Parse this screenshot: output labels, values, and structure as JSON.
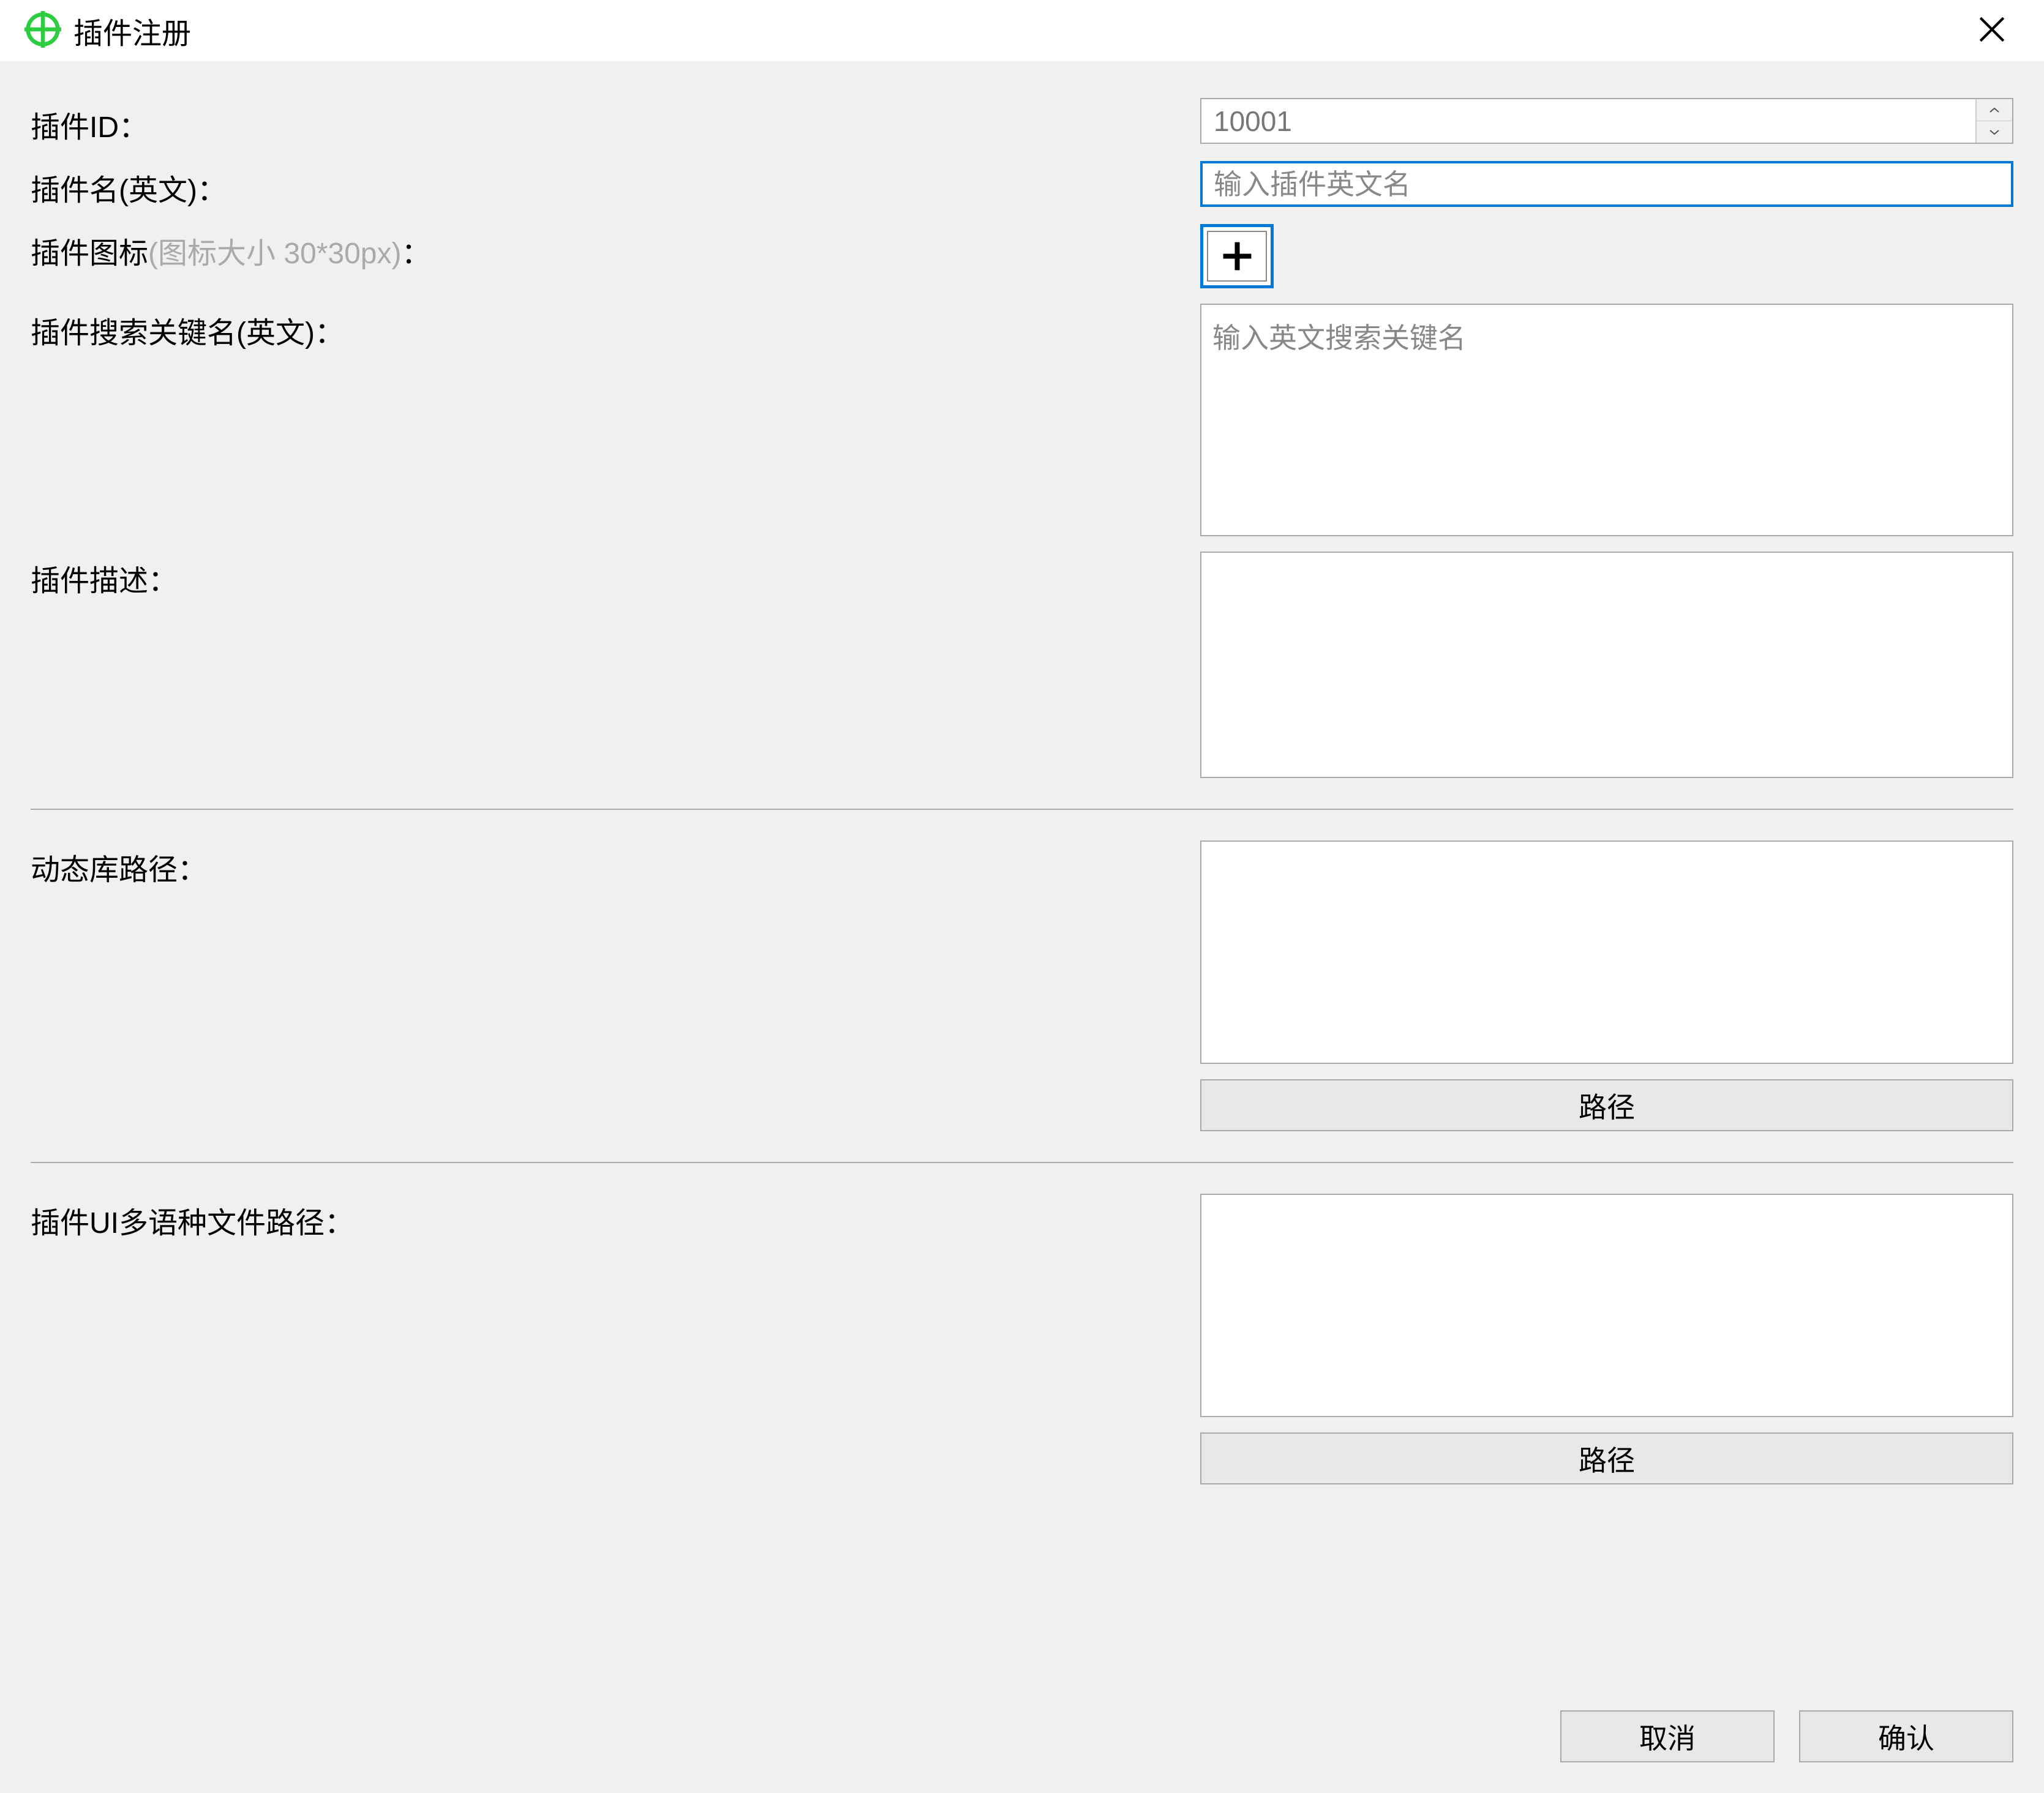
{
  "window": {
    "title": "插件注册"
  },
  "form": {
    "plugin_id": {
      "label": "插件ID：",
      "value": "10001"
    },
    "plugin_name": {
      "label": "插件名(英文)：",
      "placeholder": "输入插件英文名",
      "value": ""
    },
    "plugin_icon": {
      "label_prefix": "插件图标",
      "label_hint": "(图标大小 30*30px)",
      "label_suffix": "："
    },
    "search_key": {
      "label": "插件搜索关键名(英文)：",
      "placeholder": "输入英文搜索关键名",
      "value": ""
    },
    "description": {
      "label": "插件描述：",
      "value": ""
    },
    "lib_path": {
      "label": "动态库路径：",
      "value": "",
      "button": "路径"
    },
    "ui_path": {
      "label": "插件UI多语种文件路径：",
      "value": "",
      "button": "路径"
    }
  },
  "footer": {
    "cancel": "取消",
    "confirm": "确认"
  }
}
